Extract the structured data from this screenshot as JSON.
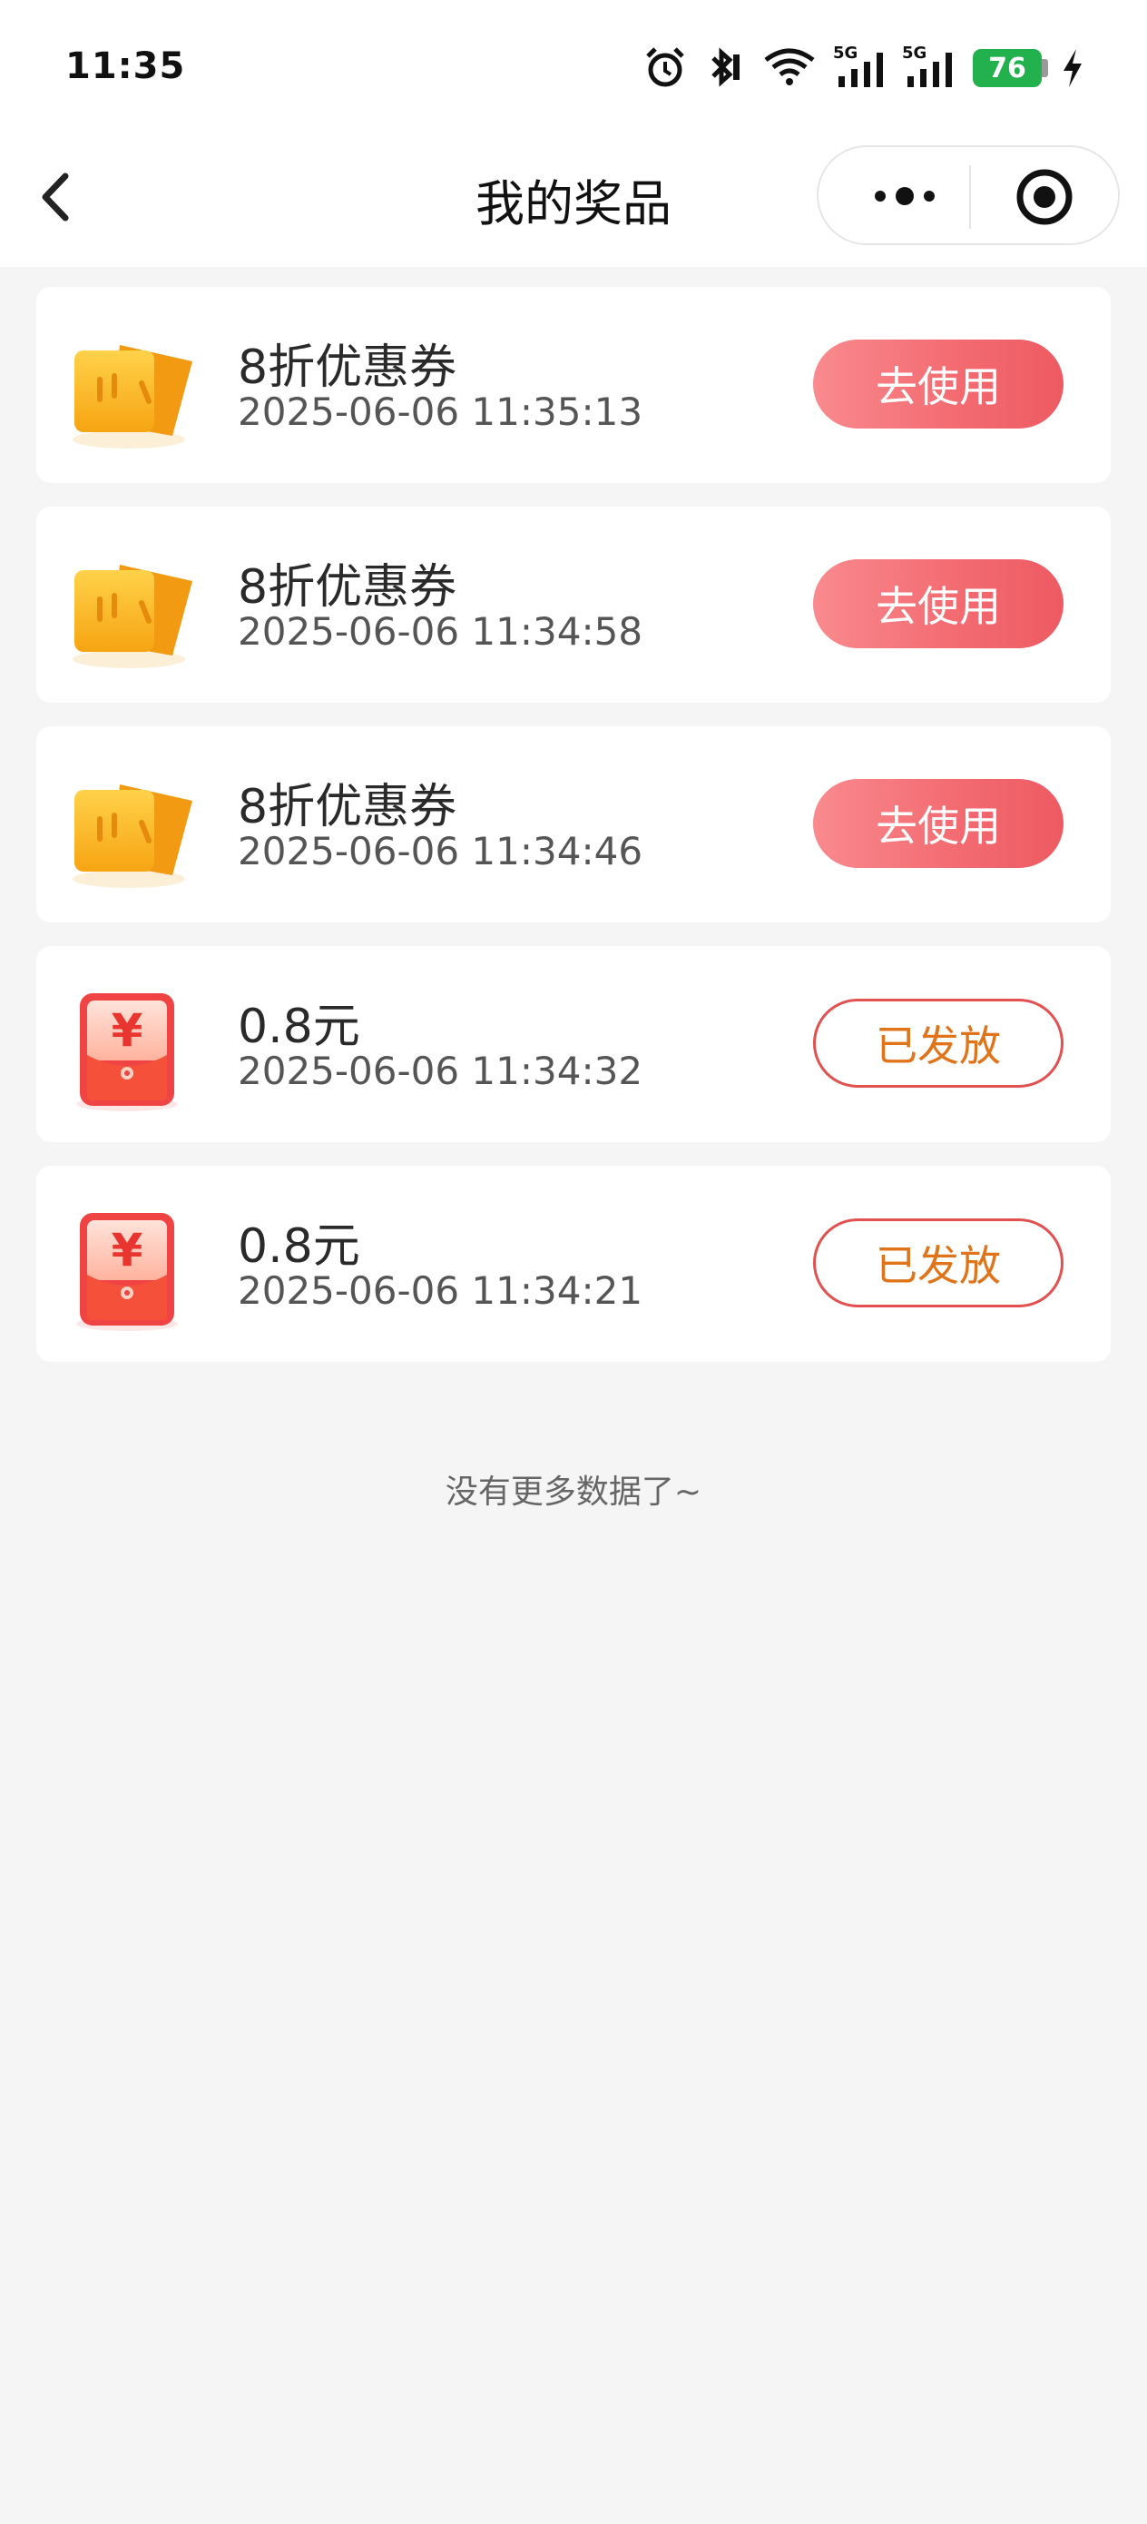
{
  "status_bar": {
    "time": "11:35",
    "battery": "76",
    "network_label_1": "5G",
    "network_label_2": "5G",
    "icons": [
      "alarm-icon",
      "bluetooth-icon",
      "wifi-icon",
      "signal-icon",
      "signal-icon",
      "battery-icon",
      "charging-icon"
    ]
  },
  "nav": {
    "title": "我的奖品",
    "back_icon": "chevron-left-icon",
    "more_icon": "more-dots-icon",
    "close_icon": "target-icon"
  },
  "prizes": [
    {
      "name": "8折优惠券",
      "time": "2025-06-06 11:35:13",
      "icon": "coupon-icon",
      "action": "去使用"
    },
    {
      "name": "8折优惠券",
      "time": "2025-06-06 11:34:58",
      "icon": "coupon-icon",
      "action": "去使用"
    },
    {
      "name": "8折优惠券",
      "time": "2025-06-06 11:34:46",
      "icon": "coupon-icon",
      "action": "去使用"
    },
    {
      "name": "0.8元",
      "time": "2025-06-06 11:34:32",
      "icon": "red-envelope-icon",
      "action": "已发放"
    },
    {
      "name": "0.8元",
      "time": "2025-06-06 11:34:21",
      "icon": "red-envelope-icon",
      "action": "已发放"
    }
  ],
  "footer": {
    "no_more": "没有更多数据了~"
  },
  "colors": {
    "use_button": "#f26a70",
    "issued_border": "#e2504f",
    "issued_text": "#e0741a",
    "background": "#f5f5f5"
  }
}
